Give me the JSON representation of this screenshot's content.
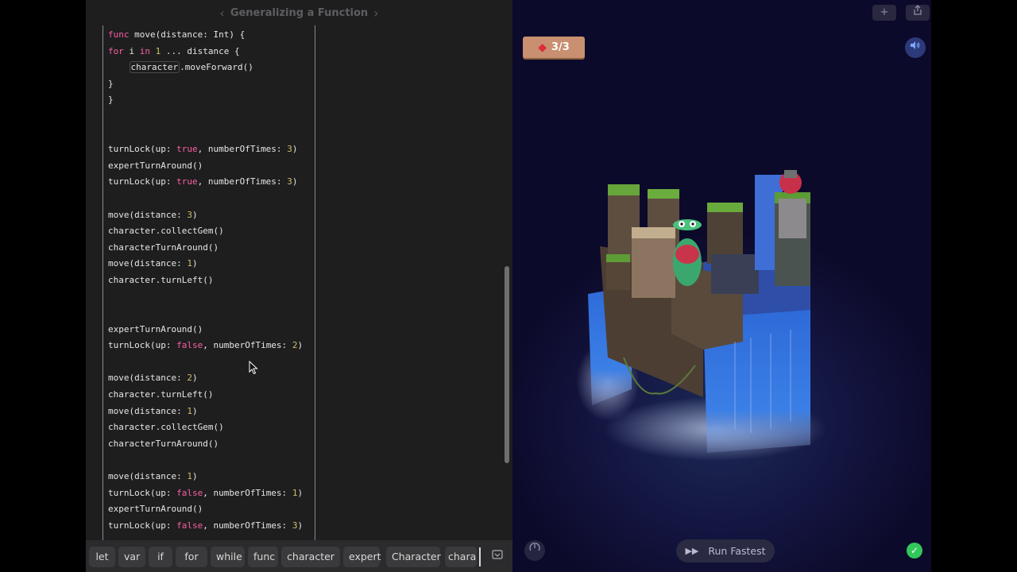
{
  "editor": {
    "title": "Generalizing a Function",
    "prev_icon": "chevron-left-icon",
    "next_icon": "chevron-right-icon",
    "code_lines": [
      [
        {
          "t": "func",
          "c": "kw"
        },
        {
          "t": " move(distance: Int) {"
        }
      ],
      [
        {
          "t": "for",
          "c": "kw"
        },
        {
          "t": " i "
        },
        {
          "t": "in",
          "c": "kw"
        },
        {
          "t": " "
        },
        {
          "t": "1",
          "c": "num"
        },
        {
          "t": " ... distance {"
        }
      ],
      [
        {
          "t": "    "
        },
        {
          "t": "character",
          "c": "boxed"
        },
        {
          "t": ".moveForward()"
        }
      ],
      [
        {
          "t": "}"
        }
      ],
      [
        {
          "t": "}"
        }
      ],
      [],
      [],
      [
        {
          "t": "turnLock(up: "
        },
        {
          "t": "true",
          "c": "kw"
        },
        {
          "t": ", numberOfTimes: "
        },
        {
          "t": "3",
          "c": "num"
        },
        {
          "t": ")"
        }
      ],
      [
        {
          "t": "expertTurnAround()"
        }
      ],
      [
        {
          "t": "turnLock(up: "
        },
        {
          "t": "true",
          "c": "kw"
        },
        {
          "t": ", numberOfTimes: "
        },
        {
          "t": "3",
          "c": "num"
        },
        {
          "t": ")"
        }
      ],
      [],
      [
        {
          "t": "move(distance: "
        },
        {
          "t": "3",
          "c": "num"
        },
        {
          "t": ")"
        }
      ],
      [
        {
          "t": "character.collectGem()"
        }
      ],
      [
        {
          "t": "characterTurnAround()"
        }
      ],
      [
        {
          "t": "move(distance: "
        },
        {
          "t": "1",
          "c": "num"
        },
        {
          "t": ")"
        }
      ],
      [
        {
          "t": "character.turnLeft()"
        }
      ],
      [],
      [],
      [
        {
          "t": "expertTurnAround()"
        }
      ],
      [
        {
          "t": "turnLock(up: "
        },
        {
          "t": "false",
          "c": "kw"
        },
        {
          "t": ", numberOfTimes: "
        },
        {
          "t": "2",
          "c": "num"
        },
        {
          "t": ")"
        }
      ],
      [],
      [
        {
          "t": "move(distance: "
        },
        {
          "t": "2",
          "c": "num"
        },
        {
          "t": ")"
        }
      ],
      [
        {
          "t": "character.turnLeft()"
        }
      ],
      [
        {
          "t": "move(distance: "
        },
        {
          "t": "1",
          "c": "num"
        },
        {
          "t": ")"
        }
      ],
      [
        {
          "t": "character.collectGem()"
        }
      ],
      [
        {
          "t": "characterTurnAround()"
        }
      ],
      [],
      [
        {
          "t": "move(distance: "
        },
        {
          "t": "1",
          "c": "num"
        },
        {
          "t": ")"
        }
      ],
      [
        {
          "t": "turnLock(up: "
        },
        {
          "t": "false",
          "c": "kw"
        },
        {
          "t": ", numberOfTimes: "
        },
        {
          "t": "1",
          "c": "num"
        },
        {
          "t": ")"
        }
      ],
      [
        {
          "t": "expertTurnAround()"
        }
      ],
      [
        {
          "t": "turnLock(up: "
        },
        {
          "t": "false",
          "c": "kw"
        },
        {
          "t": ", numberOfTimes: "
        },
        {
          "t": "3",
          "c": "num"
        },
        {
          "t": ")"
        }
      ]
    ],
    "shortcuts": [
      "let",
      "var",
      "if",
      "for",
      "while",
      "func",
      "character",
      "expert",
      "Character",
      "chara"
    ],
    "keyboard_icon": "keyboard-hide-icon",
    "colors": {
      "keyword": "#fc5fa3",
      "number": "#d0bf69",
      "text": "#e6e6e6",
      "background": "#1e1e1f"
    }
  },
  "scene": {
    "add_icon": "plus-icon",
    "share_icon": "share-icon",
    "gem_icon": "gem-icon",
    "gems_collected": "3",
    "gems_total": "3",
    "sound_icon": "speaker-icon",
    "speed_icon": "speedometer-icon",
    "run_icon": "fast-forward-icon",
    "run_label": "Run Fastest",
    "success_icon": "checkmark-icon",
    "colors": {
      "accent_green": "#32c75b",
      "gem_counter": "#c89070"
    }
  }
}
